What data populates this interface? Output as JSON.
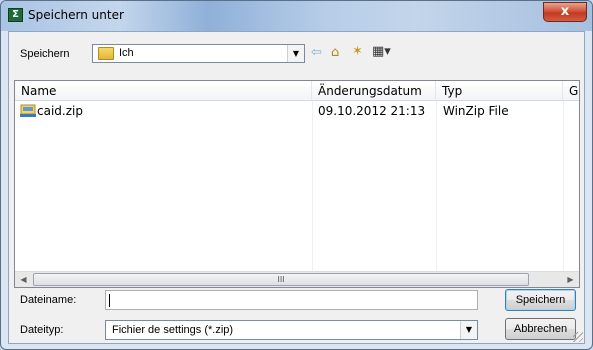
{
  "window": {
    "title": "Speichern unter",
    "close_glyph": "x"
  },
  "location": {
    "label": "Speichern",
    "current_folder": "Ich"
  },
  "toolbar": {
    "back": "⇦",
    "up": "⌂",
    "new_folder": "✶",
    "views": "▦▾"
  },
  "columns": [
    "Name",
    "Änderungsdatum",
    "Typ",
    "Größe"
  ],
  "files": [
    {
      "name": "caid.zip",
      "date": "09.10.2012 21:13",
      "type": "WinZip File",
      "icon": "zip-archive-icon"
    }
  ],
  "scrollbar": {
    "left_glyph": "◀",
    "right_glyph": "▶",
    "grip_glyph": "III"
  },
  "filename": {
    "label": "Dateiname:",
    "value": ""
  },
  "filetype": {
    "label": "Dateityp:",
    "value": "Fichier de settings (*.zip)"
  },
  "buttons": {
    "save": "Speichern",
    "cancel": "Abbrechen"
  },
  "colors": {
    "title_bg": "#b9cfe8",
    "close_red": "#c23a23",
    "selection_blue": "#3c7fb1"
  }
}
